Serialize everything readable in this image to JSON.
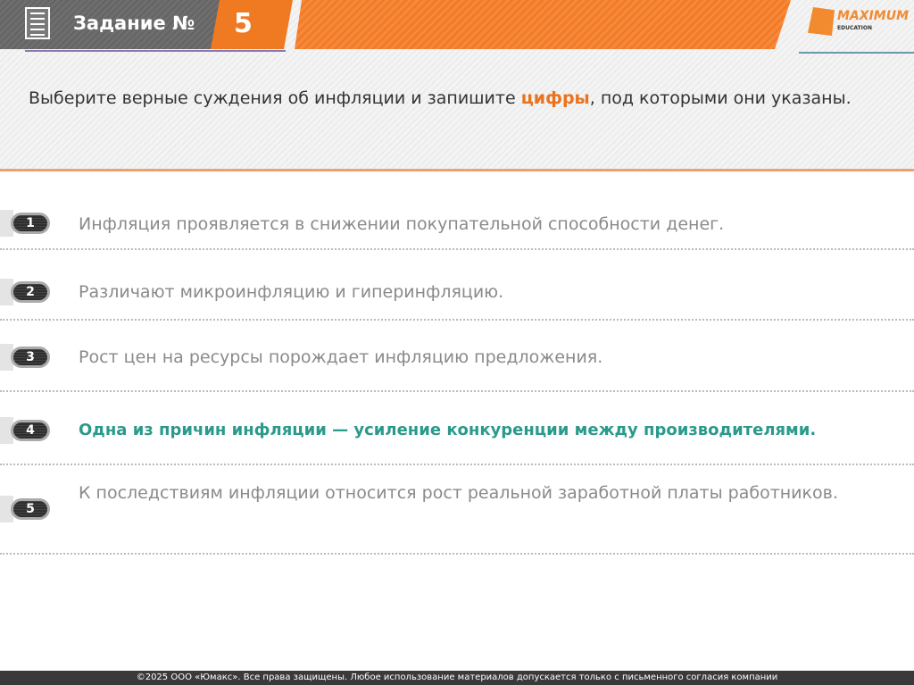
{
  "header": {
    "title": "Задание №",
    "number": "5",
    "logo_text": "MAXIMUM",
    "logo_sub": "EDUCATION",
    "accent": "#f07a22"
  },
  "question": {
    "before": "Выберите верные суждения об инфляции и запишите ",
    "highlight": "цифры",
    "after": ", под которыми они указаны."
  },
  "items": [
    {
      "num": "1",
      "text": "Инфляция проявляется в снижении покупательной способности денег.",
      "highlighted": false
    },
    {
      "num": "2",
      "text": "Различают микроинфляцию и гиперинфляцию.",
      "highlighted": false
    },
    {
      "num": "3",
      "text": "Рост цен на ресурсы порождает инфляцию предложения.",
      "highlighted": false
    },
    {
      "num": "4",
      "text": "Одна из причин инфляции — усиление конкуренции между производителями.",
      "highlighted": true
    },
    {
      "num": "5",
      "text": "К последствиям инфляции относится рост реальной заработной платы работников.",
      "highlighted": false
    }
  ],
  "footer": "©2025 ООО «Юмакс». Все права защищены. Любое использование материалов допускается только с  письменного согласия компании"
}
